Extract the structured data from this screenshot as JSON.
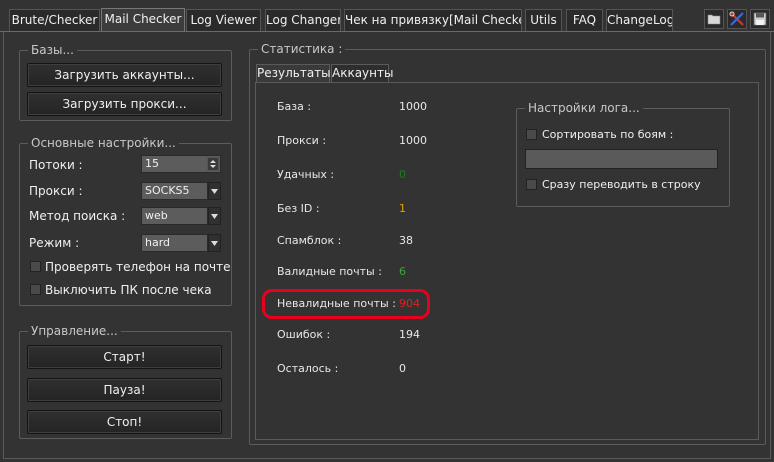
{
  "tabs": [
    {
      "label": "Brute/Checker"
    },
    {
      "label": "Mail Checker"
    },
    {
      "label": "Log  Viewer"
    },
    {
      "label": "Log Changer"
    },
    {
      "label": "Чек на привязку[Mail Checker]"
    },
    {
      "label": "Utils"
    },
    {
      "label": "FAQ"
    },
    {
      "label": "ChangeLog"
    }
  ],
  "toolbar_icons": [
    "folder-icon",
    "tools-icon",
    "save-icon"
  ],
  "bases": {
    "title": "Базы...",
    "load_accounts": "Загрузить аккаунты...",
    "load_proxies": "Загрузить прокси..."
  },
  "settings": {
    "title": "Основные настройки...",
    "threads_label": "Потоки :",
    "threads_value": "15",
    "proxy_label": "Прокси :",
    "proxy_value": "SOCKS5",
    "search_label": "Метод поиска :",
    "search_value": "web",
    "mode_label": "Режим  :",
    "mode_value": "hard",
    "check_phone": "Проверять телефон на почте",
    "shutdown": "Выключить ПК после чека"
  },
  "control": {
    "title": "Управление...",
    "start": "Старт!",
    "pause": "Пауза!",
    "stop": "Стоп!"
  },
  "stats": {
    "title": "Статистика :",
    "tabs": [
      "Результаты",
      "Аккаунты"
    ],
    "rows": [
      {
        "label": "База :",
        "value": "1000",
        "color": "#e8e8e8"
      },
      {
        "label": "Прокси :",
        "value": "1000",
        "color": "#e8e8e8"
      },
      {
        "label": "Удачных :",
        "value": "0",
        "color": "#1f7a1f"
      },
      {
        "label": "Без ID :",
        "value": "1",
        "color": "#e8a000"
      },
      {
        "label": "Спамблок :",
        "value": "38",
        "color": "#e8e8e8"
      },
      {
        "label": "Валидные почты :",
        "value": "6",
        "color": "#3aa63a"
      },
      {
        "label": "Невалидные почты :",
        "value": "904",
        "color": "#e02020"
      },
      {
        "label": "Ошибок :",
        "value": "194",
        "color": "#e8e8e8"
      },
      {
        "label": "Осталось :",
        "value": "0",
        "color": "#e8e8e8"
      }
    ]
  },
  "log_settings": {
    "title": "Настройки лога...",
    "sort_by_fights": "Сортировать по боям :",
    "to_string": "Сразу переводить в строку"
  },
  "colors": {
    "background": "#333333",
    "highlight": "#e8001c"
  }
}
